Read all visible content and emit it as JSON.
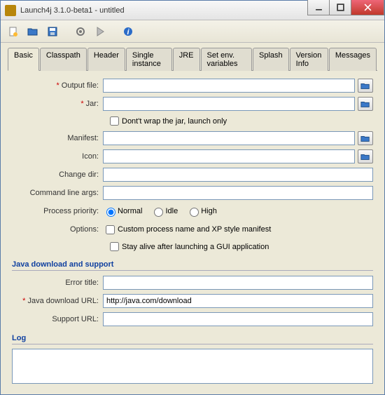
{
  "window": {
    "title": "Launch4j 3.1.0-beta1 - untitled"
  },
  "toolbar": {
    "new": "new",
    "open": "open",
    "save": "save",
    "settings": "settings",
    "run": "run",
    "info": "info"
  },
  "tabs": [
    "Basic",
    "Classpath",
    "Header",
    "Single instance",
    "JRE",
    "Set env. variables",
    "Splash",
    "Version Info",
    "Messages"
  ],
  "basic": {
    "output_file_label": "Output file:",
    "output_file": "",
    "jar_label": "Jar:",
    "jar": "",
    "dont_wrap_label": "Dont't wrap the jar, launch only",
    "dont_wrap": false,
    "manifest_label": "Manifest:",
    "manifest": "",
    "icon_label": "Icon:",
    "icon": "",
    "change_dir_label": "Change dir:",
    "change_dir": "",
    "cmdline_label": "Command line args:",
    "cmdline": "",
    "priority_label": "Process priority:",
    "priority_options": {
      "normal": "Normal",
      "idle": "Idle",
      "high": "High"
    },
    "priority": "normal",
    "options_label": "Options:",
    "custom_process_label": "Custom process name and XP style manifest",
    "custom_process": false,
    "stay_alive_label": "Stay alive after launching a GUI application",
    "stay_alive": false
  },
  "java_section": {
    "title": "Java download and support",
    "error_title_label": "Error title:",
    "error_title": "",
    "download_url_label": "Java download URL:",
    "download_url": "http://java.com/download",
    "support_url_label": "Support URL:",
    "support_url": ""
  },
  "log": {
    "title": "Log",
    "content": ""
  }
}
